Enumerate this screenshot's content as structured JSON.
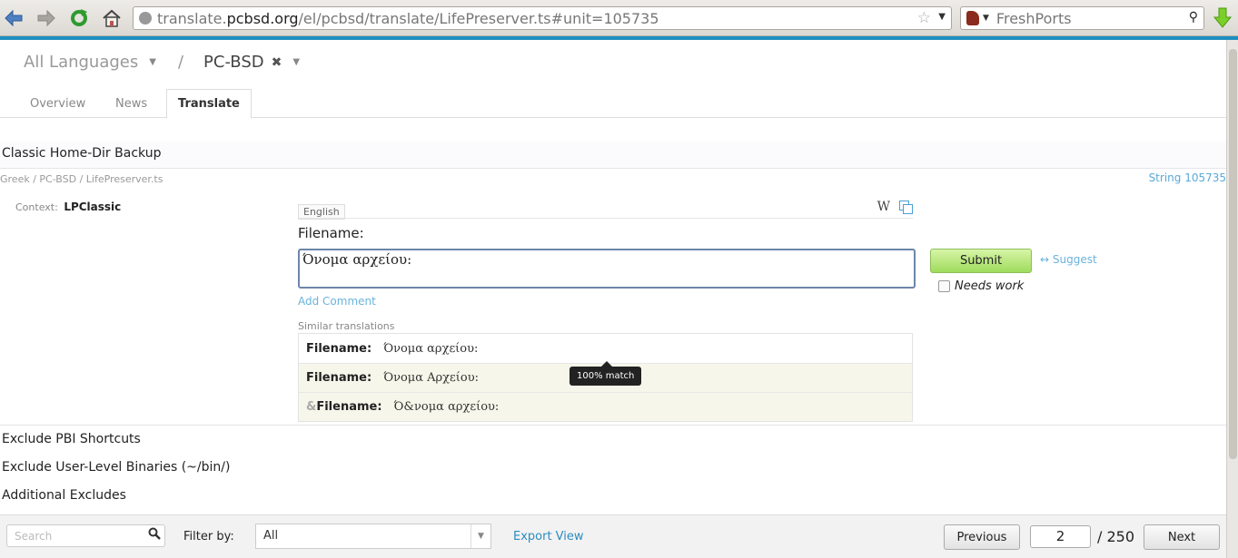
{
  "browser": {
    "url_prefix": "translate.",
    "url_host": "pcbsd.org",
    "url_path": "/el/pcbsd/translate/LifePreserver.ts#unit=105735",
    "search_engine_text": "FreshPorts"
  },
  "breadcrumb": {
    "language": "All Languages",
    "separator": "/",
    "project": "PC-BSD"
  },
  "tabs": [
    {
      "label": "Overview"
    },
    {
      "label": "News"
    },
    {
      "label": "Translate"
    }
  ],
  "unit": {
    "previous_title": "Classic Home-Dir Backup",
    "path": "Greek / PC-BSD / LifePreserver.ts",
    "string_id": "String 105735",
    "context_label": "Context:",
    "context_value": "LPClassic",
    "source_language": "English",
    "source_text": "Filename:",
    "target_text": "Όνομα αρχείου:",
    "add_comment": "Add Comment",
    "submit_label": "Submit",
    "suggest_label": "↔ Suggest",
    "needs_work_label": "Needs work",
    "needs_work_checked": false
  },
  "similar": {
    "label": "Similar translations",
    "rows": [
      {
        "accel": "",
        "source": "Filename:",
        "translation": "Όνομα αρχείου:"
      },
      {
        "accel": "",
        "source": "Filename:",
        "translation": "Όνομα Αρχείου:"
      },
      {
        "accel": "&",
        "source": "Filename:",
        "translation": "Ό&νομα αρχείου:"
      }
    ],
    "tooltip": "100% match"
  },
  "next_units": [
    {
      "label": "Exclude PBI Shortcuts"
    },
    {
      "label": "Exclude User-Level Binaries (~/bin/)"
    },
    {
      "label": "Additional Excludes"
    }
  ],
  "footer": {
    "search_placeholder": "Search",
    "filter_label": "Filter by:",
    "filter_value": "All",
    "export_label": "Export View",
    "previous_label": "Previous",
    "current_page": "2",
    "total_pages": "/ 250",
    "next_label": "Next"
  },
  "colors": {
    "accent": "#1f8fbf",
    "link": "#6ab3dc",
    "submit": "#9fdc5c"
  }
}
